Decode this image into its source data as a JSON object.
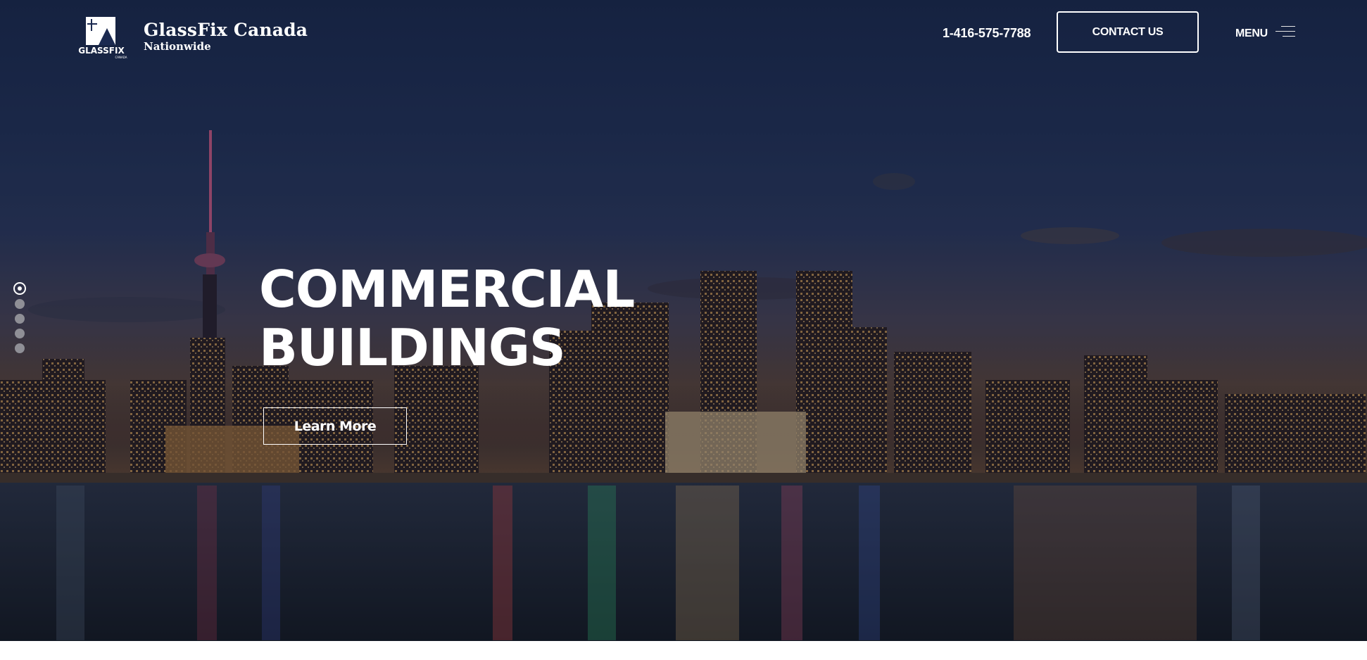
{
  "header": {
    "brand_name": "GlassFix Canada",
    "brand_subtitle": "Nationwide",
    "logo_text": "GLASSFIX",
    "logo_subtext": "CANADA",
    "phone": "1-416-575-7788",
    "contact_button": "CONTACT US",
    "menu_label": "MENU",
    "menu_icon": "hamburger-icon"
  },
  "hero": {
    "headline_line1": "COMMERCIAL",
    "headline_line2": "BUILDINGS",
    "cta_label": "Learn More",
    "slide_count": 5,
    "active_slide": 1
  },
  "colors": {
    "text": "#ffffff",
    "sky_top": "#1b2a50",
    "water": "#1a1e28",
    "indicator_inactive": "#8f8f96"
  }
}
